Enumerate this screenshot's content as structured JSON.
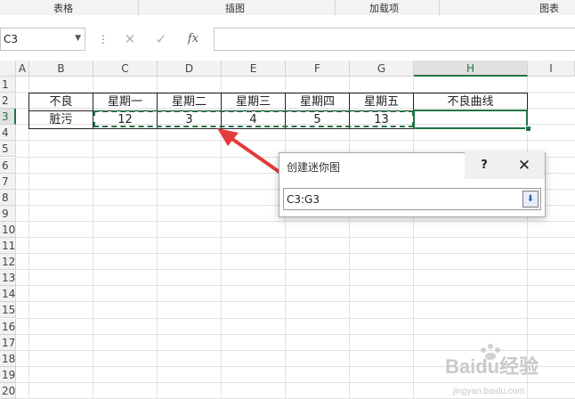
{
  "ribbon": {
    "groups": [
      "表格",
      "插图",
      "加载项",
      "图表"
    ]
  },
  "formula_bar": {
    "name_box": "C3",
    "fx_label": "fx",
    "cancel": "✕",
    "enter": "✓",
    "formula": ""
  },
  "columns": [
    "A",
    "B",
    "C",
    "D",
    "E",
    "F",
    "G",
    "H",
    "I"
  ],
  "rows": [
    "1",
    "2",
    "3",
    "4",
    "5",
    "6",
    "7",
    "8",
    "9",
    "10",
    "11",
    "12",
    "13",
    "14",
    "15",
    "16",
    "17",
    "18",
    "19",
    "20"
  ],
  "table": {
    "header": [
      "不良",
      "星期一",
      "星期二",
      "星期三",
      "星期四",
      "星期五",
      "不良曲线"
    ],
    "row": [
      "脏污",
      "12",
      "3",
      "4",
      "5",
      "13",
      ""
    ]
  },
  "dialog": {
    "title": "创建迷你图",
    "help": "?",
    "close": "✕",
    "range_value": "C3:G3"
  },
  "watermark": {
    "text": "Baidu经验",
    "sub": "jingyan.baidu.com"
  }
}
